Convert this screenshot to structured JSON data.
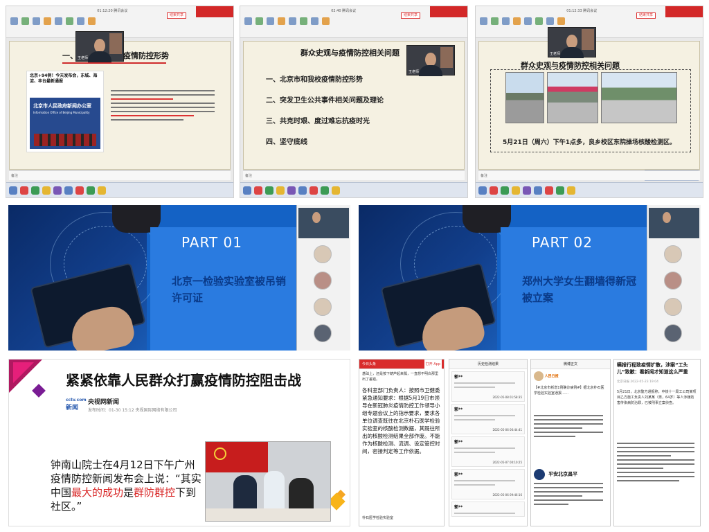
{
  "row1": {
    "cap1": {
      "top_title": "01:12:20  腾讯会议",
      "meet_btn": "结束共享",
      "video_label": "王老师",
      "slide_title": "一、北京市和我校疫情防控形势",
      "news_title": "北京+94例！今天发布会，东城、海淀、丰台最新通报",
      "news_img_caption": "北京市人民政府新闻办公室",
      "news_img_caption_en": "Information Office of Beijing Municipality",
      "notes": "备注"
    },
    "cap2": {
      "top_title": "02:40  腾讯会议",
      "meet_btn": "结束共享",
      "video_label": "王老师",
      "slide_title": "群众史观与疫情防控相关问题",
      "toc": [
        "一、北京市和我校疫情防控形势",
        "二、突发卫生公共事件相关问题及理论",
        "三、共克时艰、度过难忘抗疫时光",
        "四、坚守底线"
      ],
      "notes": "备注"
    },
    "cap3": {
      "top_title": "01:12:33  腾讯会议",
      "meet_btn": "结束共享",
      "video_label": "王老师",
      "slide_title": "群众史观与疫情防控相关问题",
      "photo_caption": "5月21日（周六）下午1点多，良乡校区东院操场核酸检测区。",
      "notes": "备注",
      "toast": "激活 Windows"
    }
  },
  "row2": {
    "part1": {
      "title": "PART  01",
      "subtitle": "北京一检验实验室被吊销许可证"
    },
    "part2": {
      "title": "PART  02",
      "subtitle": "郑州大学女生翻墙得新冠被立案"
    }
  },
  "row3": {
    "news": {
      "headline": "紧紧依靠人民群众打赢疫情防控阻击战",
      "logo_small": "cctv.com",
      "logo_big": "新闻",
      "source": "央视网新闻",
      "meta": "发布时间：01-30  15:12    央视国际网络有限公司",
      "quote_part1": "钟南山院士在4月12日下午广州疫情防控新闻发布会上说：“其实中国",
      "quote_em1": "最大的成功",
      "quote_part2": "是",
      "quote_em2": "群防群控",
      "quote_part3": "下到社区。”"
    },
    "phone1": {
      "header": "今日头条",
      "open_btn": "打开 App",
      "intro": "基础上，还是按下葫芦起来瓢，一直想不明白那里出了差错。",
      "body": "各科室部门负责人：按照市卫健委紧急通知要求：根据5月19日市领导在新冠肺炎疫情防控工作领导小组专题会议上的指示要求，要求各单位调查既往在北京朴石医学检验实验室的核酸检测数据，其既往所出的核酸检测结果全部作废。不能作为核酸检测、流调、设定管控时间，密接判定等工作依据。",
      "footer": "朴石医学检验实验室"
    },
    "phone2": {
      "header": "历史检测结果",
      "records": [
        {
          "name": "郭**",
          "date": "2022-05-08 01:58:35"
        },
        {
          "name": "郭**",
          "date": "2022-05-06 06:44:41"
        },
        {
          "name": "郭**",
          "date": "2022-05-07 00:10:25"
        },
        {
          "name": "郭**",
          "date": "2022-05-06 09:46:16"
        },
        {
          "name": "郭**",
          "date": "2022-05-05"
        }
      ]
    },
    "phone3": {
      "header": "微博正文",
      "user": "人民日报",
      "body": "【#北京市新增1例确诊病例#】据北京朴石医学检验实验室通报……",
      "police": "平安北京昌平"
    },
    "phone4": {
      "title": "瞒报行程致疫情扩散，涉案“工头儿”致歉：看新闻才知道这么严重",
      "meta": "北京日报  2022-05-23 19:04",
      "body": "5月21日，北京警方通报称，中铁十一局工公司某项目乙方施工负责人刘某某（男，64岁）等人涉嫌妨害传染病防治罪，已被刑事立案侦查。"
    }
  }
}
